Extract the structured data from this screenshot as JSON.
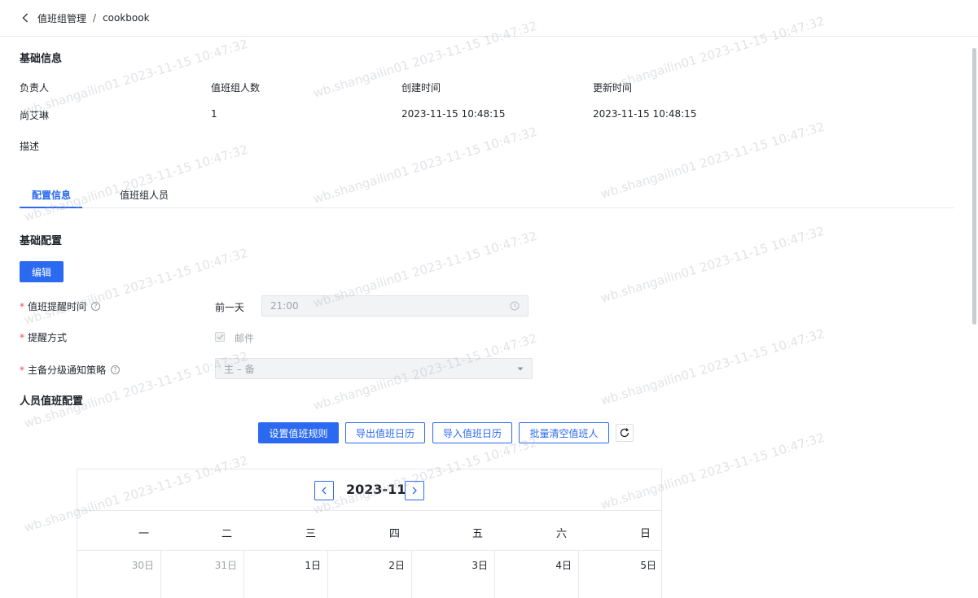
{
  "breadcrumb": {
    "parent": "值班组管理",
    "separator": "/",
    "current": "cookbook"
  },
  "basic_info": {
    "title": "基础信息",
    "fields": [
      {
        "label": "负责人",
        "value": "尚艾琳"
      },
      {
        "label": "值班组人数",
        "value": "1"
      },
      {
        "label": "创建时间",
        "value": "2023-11-15 10:48:15"
      },
      {
        "label": "更新时间",
        "value": "2023-11-15 10:48:15"
      }
    ],
    "description_label": "描述"
  },
  "tabs": [
    {
      "label": "配置信息",
      "active": true
    },
    {
      "label": "值班组人员",
      "active": false
    }
  ],
  "basic_config": {
    "title": "基础配置",
    "edit_label": "编辑",
    "reminder": {
      "label": "值班提醒时间",
      "prefix": "前一天",
      "time_value": "21:00"
    },
    "method": {
      "label": "提醒方式",
      "option": "邮件",
      "checked": true
    },
    "strategy": {
      "label": "主备分级通知策略",
      "value": "主 – 备"
    }
  },
  "schedule": {
    "title": "人员值班配置",
    "buttons": {
      "set_rule": "设置值班规则",
      "export": "导出值班日历",
      "import": "导入值班日历",
      "clear": "批量清空值班人"
    }
  },
  "calendar": {
    "month": "2023-11",
    "weekdays": [
      "一",
      "二",
      "三",
      "四",
      "五",
      "六",
      "日"
    ],
    "first_row": [
      {
        "label": "30日",
        "muted": true
      },
      {
        "label": "31日",
        "muted": true
      },
      {
        "label": "1日",
        "muted": false
      },
      {
        "label": "2日",
        "muted": false
      },
      {
        "label": "3日",
        "muted": false
      },
      {
        "label": "4日",
        "muted": false
      },
      {
        "label": "5日",
        "muted": false
      }
    ]
  },
  "watermark": "wb.shangailin01 2023-11-15 10:47:32",
  "colors": {
    "primary": "#2b6af0",
    "required": "#f54a45",
    "text": "#1f2329",
    "muted": "#a0a4ab"
  }
}
